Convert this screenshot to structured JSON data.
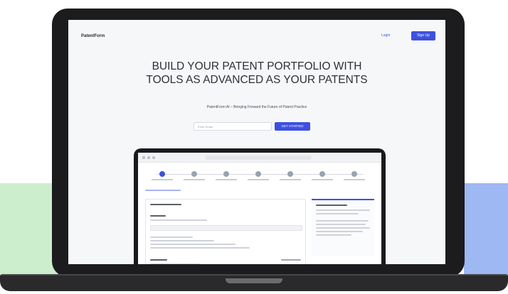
{
  "site": {
    "brand": "PatentForm",
    "nav_login": "Login",
    "nav_signup": "Sign Up"
  },
  "hero": {
    "title": "BUILD YOUR PATENT PORTFOLIO WITH TOOLS AS ADVANCED AS YOUR PATENTS",
    "subtitle": "PatentForm AI – Bringing Forward the Future of Patent Practice",
    "email_placeholder": "Enter Email",
    "cta_label": "GET STARTED"
  },
  "colors": {
    "accent": "#3d50e0",
    "band_left": "#cdeecd",
    "band_right": "#9db8f2",
    "laptop": "#1c1c1e"
  }
}
